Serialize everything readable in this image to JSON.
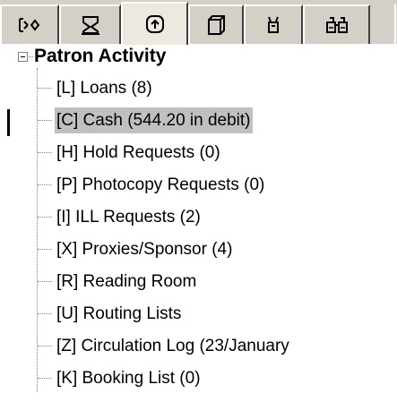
{
  "tabs": [
    {
      "icon": "transfer-icon"
    },
    {
      "icon": "patron-card-icon"
    },
    {
      "icon": "activity-icon"
    },
    {
      "icon": "document-icon"
    },
    {
      "icon": "tools-icon"
    },
    {
      "icon": "binoculars-icon"
    }
  ],
  "active_tab_index": 2,
  "tree": {
    "root_label": "Patron Activity",
    "expander_state": "expanded",
    "selected_index": 1,
    "items": [
      {
        "label": "[L] Loans (8)"
      },
      {
        "label": "[C] Cash (544.20 in debit)"
      },
      {
        "label": "[H] Hold Requests (0)"
      },
      {
        "label": "[P] Photocopy Requests (0)"
      },
      {
        "label": "[I] ILL Requests (2)"
      },
      {
        "label": "[X] Proxies/Sponsor (4)"
      },
      {
        "label": "[R] Reading Room"
      },
      {
        "label": "[U] Routing Lists"
      },
      {
        "label": "[Z] Circulation Log (23/January"
      },
      {
        "label": "[K] Booking List (0)"
      }
    ]
  },
  "colors": {
    "toolbar_bg": "#d4d0c8",
    "selection_bg": "#c0c0c0",
    "tree_line": "#808080"
  }
}
